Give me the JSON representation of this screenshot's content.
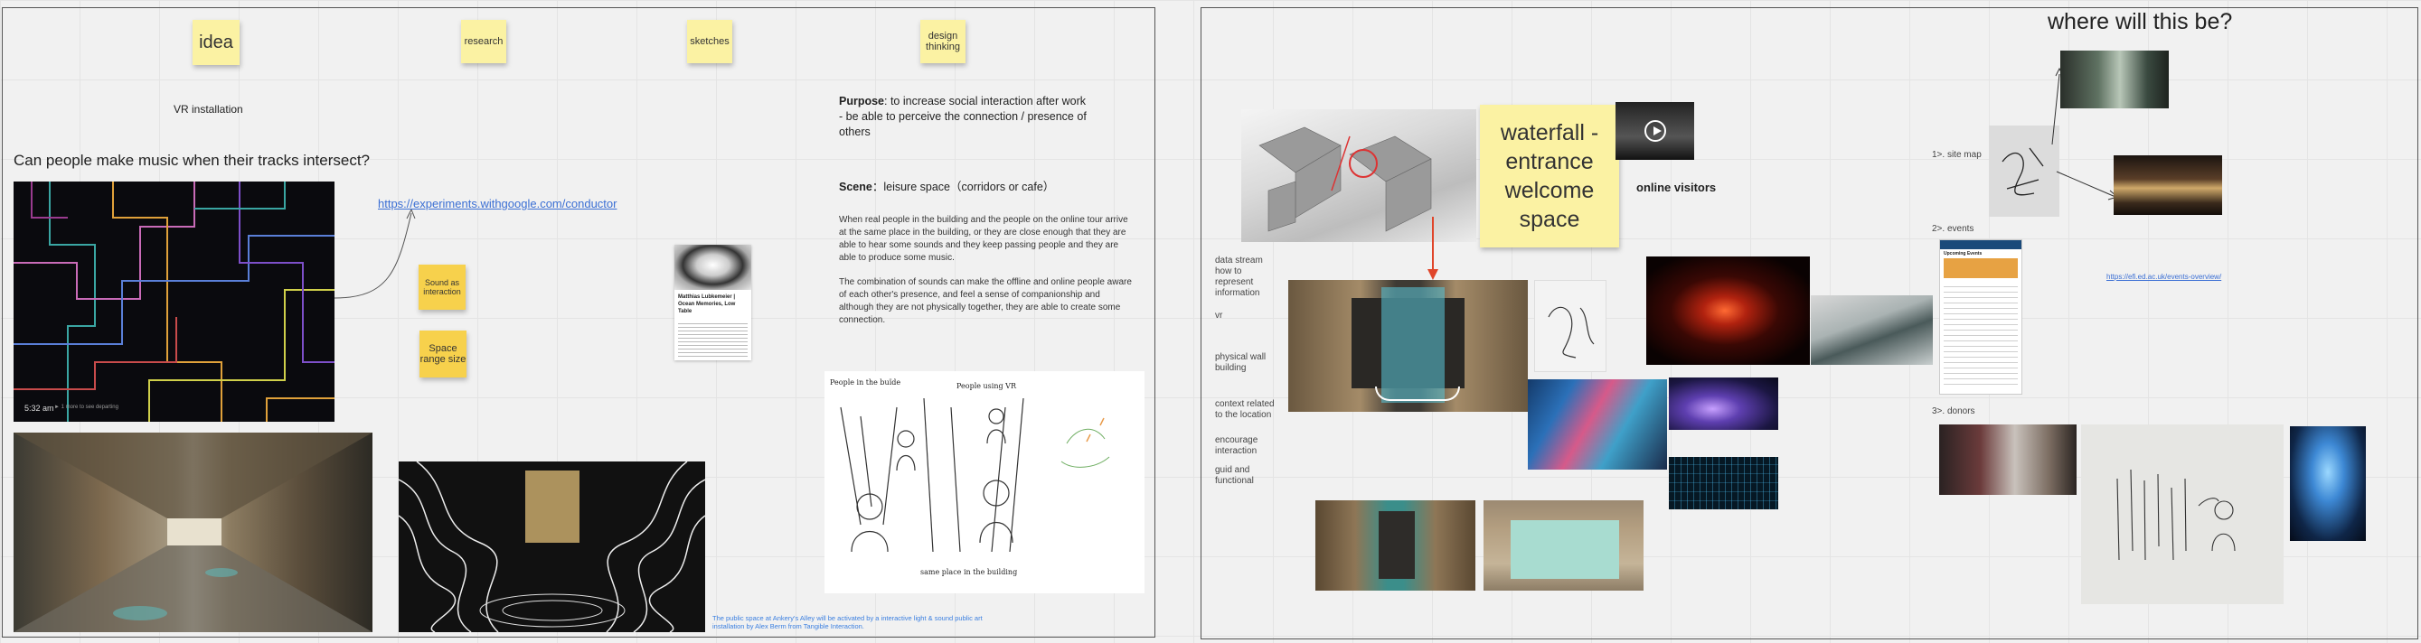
{
  "stickies": {
    "idea": "idea",
    "research": "research",
    "sketches": "sketches",
    "design_thinking": "design thinking",
    "sound_interaction": "Sound as interaction",
    "space_range": "Space range size",
    "waterfall": "waterfall - entrance welcome space"
  },
  "left": {
    "vr_installation": "VR installation",
    "question": "Can people make music when their tracks intersect?",
    "conductor_link": "https://experiments.withgoogle.com/conductor",
    "conductor_caption": "5:32 am",
    "conductor_hint": "► 1 more to see departing",
    "card_title": "Matthias Lubkemeier | Ocean Memories, Low Table",
    "purpose_label": "Purpose",
    "purpose_text": ": to increase social interaction after work",
    "purpose_sub": " - be able to perceive the connection / presence of others",
    "scene_label": "Scene",
    "scene_text": "：leisure space（corridors or cafe）",
    "para1": "When real people in the building and the people on the online tour arrive at the same place in the building, or they are close enough that they are able to hear some sounds and they keep passing people and they are able to produce some music.",
    "para2": "The combination of sounds can make the offline and online people aware of each other's presence, and feel a sense of companionship and although they are not physically together, they are able to create some connection.",
    "sketch_label_a": "People in the buïde",
    "sketch_label_b": "People using VR",
    "sketch_label_c": "same place in the building",
    "caption_blue": "The public space at Ankery's Alley will be activated by a interactive light & sound public art installation by Alex Berm from Tangible Interaction."
  },
  "right": {
    "where_title": "where will this be?",
    "online_visitors": "online visitors",
    "notes": [
      "data stream how to represent information",
      "vr",
      "physical wall building",
      "context related to the location",
      "encourage interaction",
      "guid and functional"
    ],
    "site_map": "1>. site map",
    "events": "2>. events",
    "donors": "3>. donors",
    "events_link": "https://efi.ed.ac.uk/events-overview/",
    "events_header": "Upcoming Events"
  }
}
